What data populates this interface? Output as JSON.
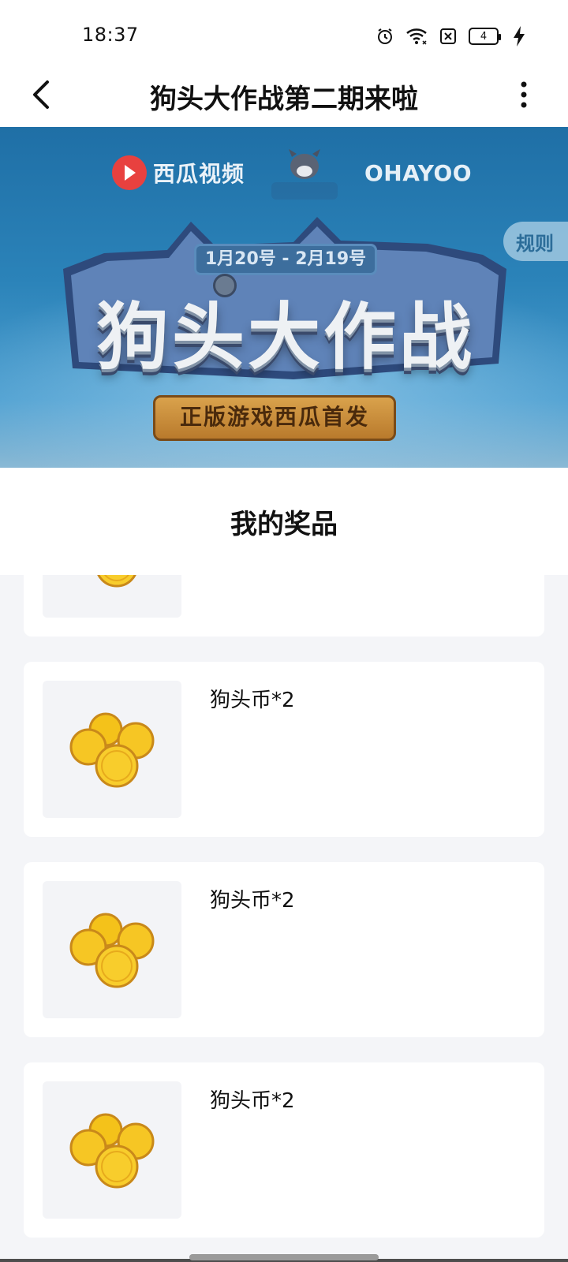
{
  "status_bar": {
    "time": "18:37",
    "battery_level": "4",
    "icons": [
      "alarm-icon",
      "wifi-icon",
      "sim-off-icon",
      "battery-icon",
      "charging-icon"
    ]
  },
  "header": {
    "title": "狗头大作战第二期来啦",
    "back_icon": "chevron-left-icon",
    "more_icon": "more-vertical-icon"
  },
  "banner": {
    "brand_xigua": "西瓜视频",
    "brand_game": "狗头大作战",
    "brand_ohayoo": "OHAYOO",
    "date_range": "1月20号 - 2月19号",
    "headline": "狗头大作战",
    "subtitle": "正版游戏西瓜首发",
    "rules_button": "规则"
  },
  "prizes": {
    "title": "我的奖品",
    "items": [
      {
        "label": ""
      },
      {
        "label": "狗头币*2"
      },
      {
        "label": "狗头币*2"
      },
      {
        "label": "狗头币*2"
      }
    ]
  },
  "colors": {
    "banner_blue": "#2b83b9",
    "list_bg": "#f4f5f8",
    "coin_gold": "#f4c21a",
    "xigua_red": "#e8413f"
  }
}
